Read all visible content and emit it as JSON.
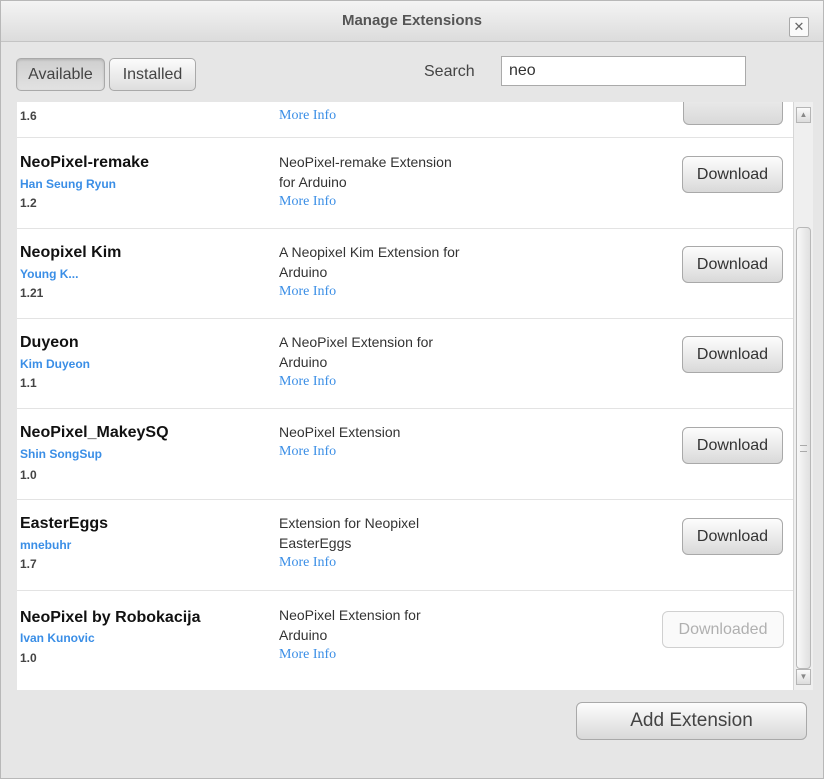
{
  "dialog": {
    "title": "Manage Extensions",
    "close_glyph": "✕"
  },
  "tabs": {
    "available": "Available",
    "installed": "Installed",
    "active": "Available"
  },
  "search": {
    "label": "Search",
    "value": "neo"
  },
  "partial_row": {
    "version": "1.6",
    "more_info": "More Info"
  },
  "extensions": [
    {
      "name": "NeoPixel-remake",
      "author": "Han Seung Ryun",
      "version": "1.2",
      "desc1": "NeoPixel-remake Extension",
      "desc2": "for Arduino",
      "more_info": "More Info",
      "action": "Download"
    },
    {
      "name": "Neopixel Kim",
      "author": "Young K...",
      "version": "1.21",
      "desc1": "A Neopixel Kim Extension for",
      "desc2": "Arduino",
      "more_info": "More Info",
      "action": "Download"
    },
    {
      "name": "Duyeon",
      "author": "Kim Duyeon",
      "version": "1.1",
      "desc1": "A NeoPixel Extension for",
      "desc2": "Arduino",
      "more_info": "More Info",
      "action": "Download"
    },
    {
      "name": "NeoPixel_MakeySQ",
      "author": "Shin SongSup",
      "version": "1.0",
      "desc1": "NeoPixel Extension",
      "desc2": "",
      "more_info": "More Info",
      "action": "Download"
    },
    {
      "name": "EasterEggs",
      "author": "mnebuhr",
      "version": "1.7",
      "desc1": "Extension for Neopixel",
      "desc2": "EasterEggs",
      "more_info": "More Info",
      "action": "Download"
    },
    {
      "name": "NeoPixel by Robokacija",
      "author": "Ivan Kunovic",
      "version": "1.0",
      "desc1": "NeoPixel Extension for",
      "desc2": "Arduino",
      "more_info": "More Info",
      "action": "Downloaded"
    }
  ],
  "footer": {
    "add_button": "Add Extension"
  },
  "colors": {
    "link": "#3a8ee6",
    "title_text": "#555555"
  },
  "scrollbar": {
    "thumb_start_fraction": 0.21,
    "thumb_size_fraction": 0.75
  }
}
